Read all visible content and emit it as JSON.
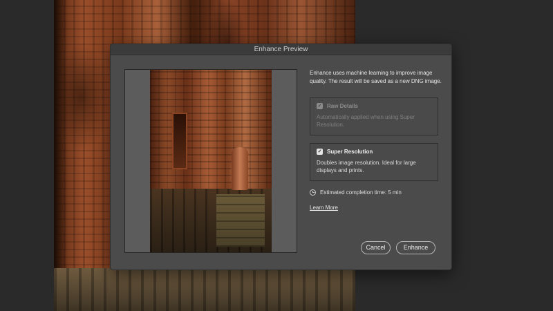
{
  "dialog": {
    "title": "Enhance Preview",
    "intro": "Enhance uses machine learning to improve image quality. The result will be saved as a new DNG image."
  },
  "options": {
    "raw_details": {
      "title": "Raw Details",
      "description": "Automatically applied when using Super Resolution.",
      "checked": true,
      "enabled": false
    },
    "super_resolution": {
      "title": "Super Resolution",
      "description": "Doubles image resolution. Ideal for large displays and prints.",
      "checked": true,
      "enabled": true
    }
  },
  "estimate": {
    "text": "Estimated completion time: 5 min",
    "icon": "clock-icon"
  },
  "learn_more": "Learn More",
  "buttons": {
    "cancel": "Cancel",
    "enhance": "Enhance"
  },
  "checkmark": "✓",
  "colors": {
    "dialog_bg": "#4b4b4b",
    "titlebar_bg": "#3b3b3b",
    "app_bg": "#2a2a2a"
  }
}
